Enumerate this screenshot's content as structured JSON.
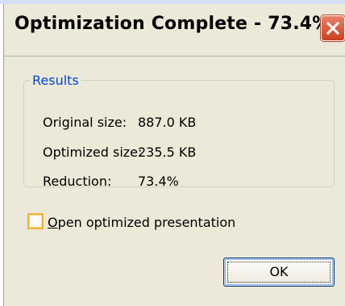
{
  "dialog": {
    "title": "Optimization Complete - 73.4%",
    "close_label": "Close"
  },
  "results": {
    "legend": "Results",
    "rows": [
      {
        "label": "Original size:",
        "value": "887.0 KB"
      },
      {
        "label": "Optimized size:",
        "value": "235.5 KB"
      },
      {
        "label": "Reduction:",
        "value": "73.4%"
      }
    ]
  },
  "options": {
    "open_checkbox": {
      "mnemonic": "O",
      "label_rest": "pen optimized presentation",
      "checked": false
    }
  },
  "buttons": {
    "ok_label": "OK"
  },
  "colors": {
    "dialog_bg": "#ece9d8",
    "legend_text": "#0046d5",
    "close_button": "#c8401e",
    "checkbox_border": "#f2b13a",
    "button_border": "#003c74"
  }
}
